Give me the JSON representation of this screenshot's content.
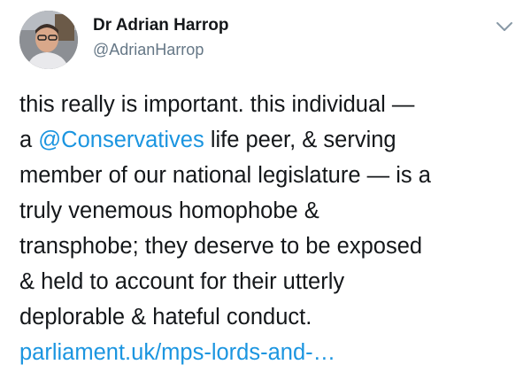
{
  "author": {
    "display_name": "Dr Adrian Harrop",
    "handle": "@AdrianHarrop"
  },
  "icons": {
    "avatar": "profile-photo",
    "menu": "chevron-down-icon"
  },
  "colors": {
    "link": "#1b95e0",
    "text": "#14171a",
    "secondary": "#657786",
    "caret": "#8899a6"
  },
  "tweet": {
    "line1": "this really is important. this individual —",
    "line2_pre": "a ",
    "mention": "@Conservatives",
    "line2_post": " life peer, & serving",
    "line3": "member of our national legislature — is a",
    "line4": "truly venemous homophobe &",
    "line5": "transphobe; they deserve to be exposed",
    "line6": "& held to account for their utterly",
    "line7": "deplorable & hateful conduct.",
    "link_text": "parliament.uk/mps-lords-and-…"
  }
}
